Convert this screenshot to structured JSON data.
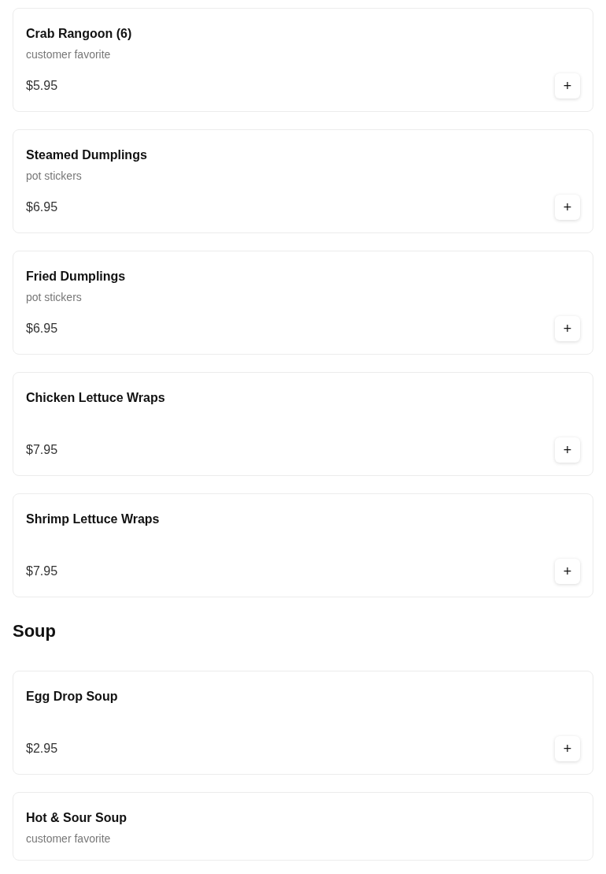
{
  "sections": [
    {
      "items": [
        {
          "name": "Crab Rangoon (6)",
          "description": "customer favorite",
          "price": "$5.95",
          "button": "+"
        },
        {
          "name": "Steamed Dumplings",
          "description": "pot stickers",
          "price": "$6.95",
          "button": "+"
        },
        {
          "name": "Fried Dumplings",
          "description": "pot stickers",
          "price": "$6.95",
          "button": "+"
        },
        {
          "name": "Chicken Lettuce Wraps",
          "price": "$7.95",
          "button": "+"
        },
        {
          "name": "Shrimp Lettuce Wraps",
          "price": "$7.95",
          "button": "+"
        }
      ]
    },
    {
      "title": "Soup",
      "items": [
        {
          "name": "Egg Drop Soup",
          "price": "$2.95",
          "button": "+"
        },
        {
          "name": "Hot & Sour Soup",
          "description": "customer favorite"
        }
      ]
    }
  ]
}
